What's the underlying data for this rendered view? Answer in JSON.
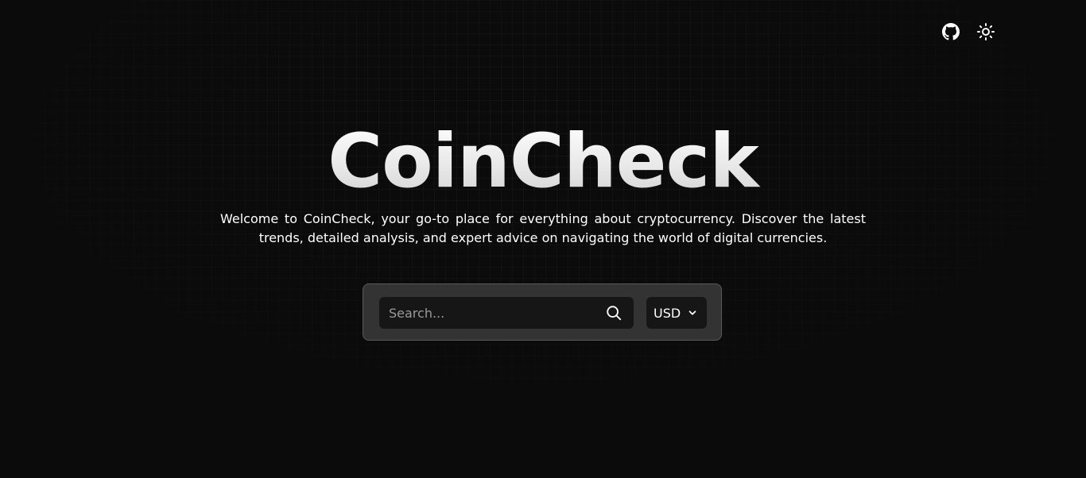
{
  "header": {
    "icons": [
      "github-icon",
      "sun-icon"
    ]
  },
  "hero": {
    "title": "CoinCheck",
    "subtitle": "Welcome to CoinCheck, your go-to place for everything about cryptocurrency. Discover the latest trends, detailed analysis, and expert advice on navigating the world of digital currencies."
  },
  "search": {
    "placeholder": "Search...",
    "value": "",
    "icon": "search-icon"
  },
  "currency": {
    "selected": "USD",
    "icon": "chevron-down-icon"
  },
  "colors": {
    "background": "#0b0b0b",
    "panel": "#333333",
    "field": "#161616",
    "text": "#ffffff",
    "placeholder": "#9a9a9a"
  }
}
